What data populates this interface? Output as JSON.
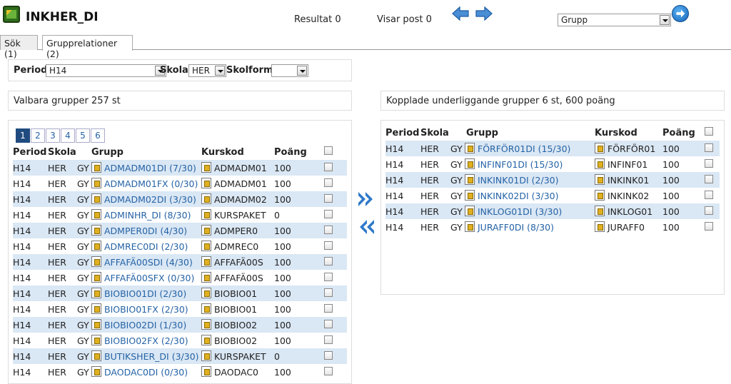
{
  "app": {
    "title": "INKHER_DI",
    "resultat": "Resultat 0",
    "visar": "Visar post 0"
  },
  "search_select": {
    "value": "Grupp"
  },
  "tabs": [
    {
      "label": "Sök (1)"
    },
    {
      "label": "Grupprelationer (2)"
    }
  ],
  "filters": {
    "period_label": "Period",
    "period_value": "H14",
    "skola_label": "Skola",
    "skola_value": "HER",
    "skolform_label": "Skolform",
    "skolform_value": ""
  },
  "left": {
    "heading": "Valbara grupper 257 st",
    "pages": [
      "1",
      "2",
      "3",
      "4",
      "5",
      "6"
    ],
    "columns": [
      "Period",
      "Skola",
      "Grupp",
      "Kurskod",
      "Poäng"
    ],
    "rows": [
      [
        "H14",
        "HER",
        "GY",
        "ADMADM01DI (7/30)",
        "ADMADM01",
        "100"
      ],
      [
        "H14",
        "HER",
        "GY",
        "ADMADM01FX (0/30)",
        "ADMADM01",
        "100"
      ],
      [
        "H14",
        "HER",
        "GY",
        "ADMADM02DI (3/30)",
        "ADMADM02",
        "100"
      ],
      [
        "H14",
        "HER",
        "GY",
        "ADMINHR_DI (8/30)",
        "KURSPAKET",
        "0"
      ],
      [
        "H14",
        "HER",
        "GY",
        "ADMPER0DI (4/30)",
        "ADMPER0",
        "100"
      ],
      [
        "H14",
        "HER",
        "GY",
        "ADMREC0DI (2/30)",
        "ADMREC0",
        "100"
      ],
      [
        "H14",
        "HER",
        "GY",
        "AFFAFÄ00SDI (4/30)",
        "AFFAFÄ00S",
        "100"
      ],
      [
        "H14",
        "HER",
        "GY",
        "AFFAFÄ00SFX (0/30)",
        "AFFAFÄ00S",
        "100"
      ],
      [
        "H14",
        "HER",
        "GY",
        "BIOBIO01DI (2/30)",
        "BIOBIO01",
        "100"
      ],
      [
        "H14",
        "HER",
        "GY",
        "BIOBIO01FX (2/30)",
        "BIOBIO01",
        "100"
      ],
      [
        "H14",
        "HER",
        "GY",
        "BIOBIO02DI (1/30)",
        "BIOBIO02",
        "100"
      ],
      [
        "H14",
        "HER",
        "GY",
        "BIOBIO02FX (2/30)",
        "BIOBIO02",
        "100"
      ],
      [
        "H14",
        "HER",
        "GY",
        "BUTIKSHER_DI (3/30)",
        "KURSPAKET",
        "0"
      ],
      [
        "H14",
        "HER",
        "GY",
        "DAODAC0DI (0/30)",
        "DAODAC0",
        "100"
      ]
    ]
  },
  "right": {
    "heading": "Kopplade underliggande grupper 6 st, 600 poäng",
    "columns": [
      "Period",
      "Skola",
      "Grupp",
      "Kurskod",
      "Poäng"
    ],
    "rows": [
      [
        "H14",
        "HER",
        "GY",
        "FÖRFÖR01DI (15/30)",
        "FÖRFÖR01",
        "100"
      ],
      [
        "H14",
        "HER",
        "GY",
        "INFINF01DI (15/30)",
        "INFINF01",
        "100"
      ],
      [
        "H14",
        "HER",
        "GY",
        "INKINK01DI (2/30)",
        "INKINK01",
        "100"
      ],
      [
        "H14",
        "HER",
        "GY",
        "INKINK02DI (3/30)",
        "INKINK02",
        "100"
      ],
      [
        "H14",
        "HER",
        "GY",
        "INKLOG01DI (3/30)",
        "INKLOG01",
        "100"
      ],
      [
        "H14",
        "HER",
        "GY",
        "JURAFF0DI (8/30)",
        "JURAFF0",
        "100"
      ]
    ]
  },
  "icons": {
    "back": "arrow-left-icon",
    "forward": "arrow-right-icon",
    "go": "go-icon",
    "add": "double-chevron-right-icon",
    "remove": "double-chevron-left-icon"
  }
}
